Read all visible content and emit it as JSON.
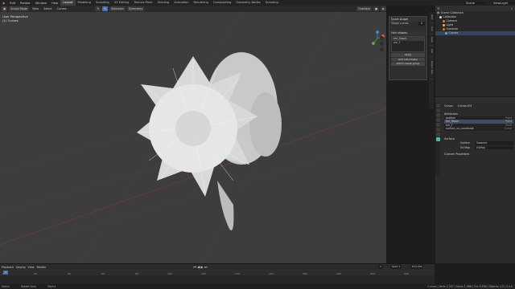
{
  "topbar": {
    "menus": [
      "Edit",
      "Render",
      "Window",
      "Help"
    ],
    "tabs": [
      "Layout",
      "Modeling",
      "Sculpting",
      "UV Editing",
      "Texture Paint",
      "Shading",
      "Animation",
      "Rendering",
      "Compositing",
      "Geometry Nodes",
      "Scripting"
    ],
    "active_tab": "Layout",
    "scene_label": "Scene",
    "view_layer_label": "ViewLayer"
  },
  "viewport_header": {
    "mode": "Sculpt Mode",
    "menus": [
      "View",
      "Select",
      "Curves"
    ],
    "options": [
      "Selection",
      "Symmetry"
    ],
    "overlay": "Overlays"
  },
  "viewport": {
    "perspective": "User Perspective",
    "object": "(1) Curves"
  },
  "npanel": {
    "title": "Tool",
    "panel1_title": "Quick shape",
    "density_label": "Shape curves",
    "density_value": "8",
    "panel2_title": "Hair shapes",
    "list": [
      "ear_flower",
      "ear_F"
    ],
    "buttons": [
      "Apply",
      "Add individually",
      "Add to Asset group"
    ]
  },
  "vertical_tabs": [
    "Item",
    "Tool",
    "View",
    "Edit",
    "Object data"
  ],
  "outliner": {
    "title": "Scene Collection",
    "items": [
      {
        "label": "Collection",
        "color": "#d9d9d9"
      },
      {
        "label": "Camera",
        "color": "#e07b3a"
      },
      {
        "label": "Light",
        "color": "#e0c03a"
      },
      {
        "label": "Suzanne",
        "color": "#e07b3a"
      },
      {
        "label": "Curves",
        "color": "#4fb8a8"
      }
    ]
  },
  "properties": {
    "object": "Curves",
    "data": "Curves.001",
    "attributes_title": "Attributes",
    "attributes": [
      {
        "name": "position",
        "domain": "Point"
      },
      {
        "name": "ear_flower",
        "domain": "Point"
      },
      {
        "name": "ear_F",
        "domain": "Point"
      },
      {
        "name": "surface_uv_coordinate",
        "domain": "Curve"
      }
    ],
    "surface_title": "Surface",
    "surface_label": "Surface",
    "surface_value": "Suzanne",
    "uvmap_label": "UV Map",
    "uvmap_value": "UVMap",
    "custom_props": "Custom Properties"
  },
  "timeline": {
    "menus": [
      "Playback",
      "Keying",
      "View",
      "Marker"
    ],
    "ticks": [
      "0",
      "20",
      "40",
      "60",
      "80",
      "100",
      "120",
      "140",
      "160",
      "180",
      "200",
      "220",
      "240"
    ],
    "current_frame": "1",
    "start_label": "Start",
    "start_value": "1",
    "end_label": "End",
    "end_value": "250"
  },
  "status": {
    "left": "Select",
    "middle": "Rotate View",
    "right": "Object",
    "stats": "Curves | Verts 2,337 | Faces 1,968 | Tris 3,936 | Objects 1/3 | 3.4.0"
  },
  "colors": {
    "accent": "#4772b3",
    "viewport_bg": "#3d3d3d"
  }
}
